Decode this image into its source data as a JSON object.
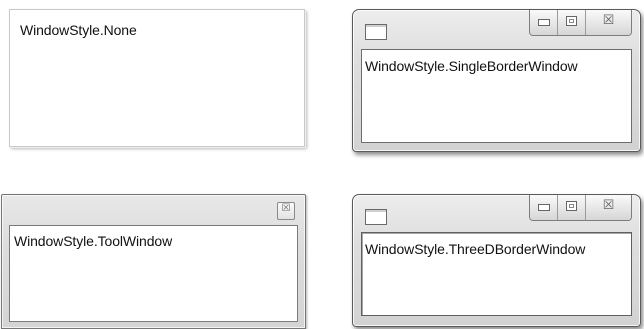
{
  "windows": {
    "none": {
      "label": "WindowStyle.None"
    },
    "single_border": {
      "label": "WindowStyle.SingleBorderWindow"
    },
    "tool": {
      "label": "WindowStyle.ToolWindow"
    },
    "three_d_border": {
      "label": "WindowStyle.ThreeDBorderWindow"
    }
  },
  "caption_buttons": {
    "minimize_icon": "minimize-icon",
    "maximize_icon": "maximize-icon",
    "close_icon": "close-icon",
    "close_glyph": "☒"
  }
}
